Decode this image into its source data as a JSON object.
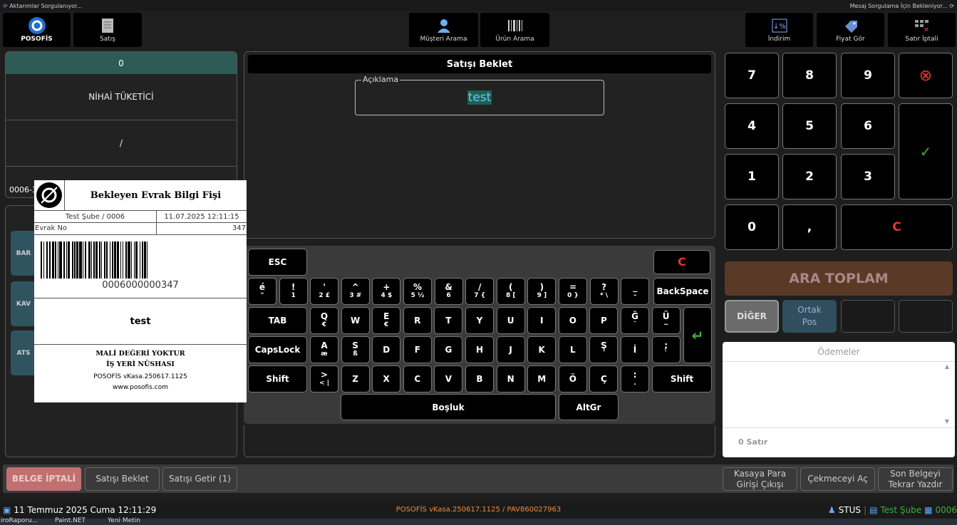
{
  "status": {
    "left": "Aktarımlar Sorgulanıyor...",
    "right": "Mesaj Sorgulama İçin Bekleniyor..."
  },
  "toolbar": {
    "posofis": "POSOFİS",
    "satis": "Satış",
    "musteri": "Müşteri Arama",
    "urun": "Ürün Arama",
    "indirim": "İndirim",
    "fiyat": "Fiyat Gör",
    "satir": "Satır İptali"
  },
  "customer": {
    "number": "0",
    "name": "NİHAİ TÜKETİCİ",
    "slash": "/",
    "code_partial": "0006-3"
  },
  "left_buttons": [
    "BAR",
    "KAV",
    "ATS"
  ],
  "dialog": {
    "title": "Satışı Beklet",
    "field_label": "Açıklama",
    "field_value": "test"
  },
  "keyboard": {
    "esc": "ESC",
    "clear": "C",
    "backspace": "BackSpace",
    "tab": "TAB",
    "capslock": "CapsLock",
    "shift": "Shift",
    "space": "Boşluk",
    "altgr": "AltGr",
    "row1": [
      [
        "é",
        "\""
      ],
      [
        "!",
        "1"
      ],
      [
        "'",
        "2 £"
      ],
      [
        "^",
        "3 #"
      ],
      [
        "+",
        "4 $"
      ],
      [
        "%",
        "5 ½"
      ],
      [
        "&",
        "6"
      ],
      [
        "/",
        "7 {"
      ],
      [
        "(",
        "8 ["
      ],
      [
        ")",
        "9 ]"
      ],
      [
        "=",
        "0 }"
      ],
      [
        "?",
        "* \\"
      ],
      [
        "_",
        "-"
      ]
    ],
    "row2": [
      [
        "Q",
        "€"
      ],
      [
        "W",
        ""
      ],
      [
        "E",
        "€"
      ],
      [
        "R",
        ""
      ],
      [
        "T",
        ""
      ],
      [
        "Y",
        ""
      ],
      [
        "U",
        ""
      ],
      [
        "I",
        ""
      ],
      [
        "O",
        ""
      ],
      [
        "P",
        ""
      ],
      [
        "Ğ",
        "¨"
      ],
      [
        "Ü",
        "~"
      ]
    ],
    "row3": [
      [
        "A",
        "æ"
      ],
      [
        "S",
        "ß"
      ],
      [
        "D",
        ""
      ],
      [
        "F",
        ""
      ],
      [
        "G",
        ""
      ],
      [
        "H",
        ""
      ],
      [
        "J",
        ""
      ],
      [
        "K",
        ""
      ],
      [
        "L",
        ""
      ],
      [
        "Ş",
        "´"
      ],
      [
        "İ",
        ""
      ],
      [
        ";",
        "`"
      ]
    ],
    "row4": [
      [
        ">",
        "< |"
      ],
      [
        "Z",
        ""
      ],
      [
        "X",
        ""
      ],
      [
        "C",
        ""
      ],
      [
        "V",
        ""
      ],
      [
        "B",
        ""
      ],
      [
        "N",
        ""
      ],
      [
        "M",
        ""
      ],
      [
        "Ö",
        ""
      ],
      [
        "Ç",
        ""
      ],
      [
        ":",
        "."
      ]
    ]
  },
  "numpad": {
    "k7": "7",
    "k8": "8",
    "k9": "9",
    "k4": "4",
    "k5": "5",
    "k6": "6",
    "k1": "1",
    "k2": "2",
    "k3": "3",
    "k0": "0",
    "comma": ",",
    "clear": "C"
  },
  "ara_toplam": "ARA TOPLAM",
  "diger": "DİĞER",
  "ortak_pos": "Ortak Pos",
  "payments": {
    "title": "Ödemeler",
    "rows": "0 Satır"
  },
  "receipt": {
    "title": "Bekleyen Evrak Bilgi Fişi",
    "branch": "Test Şube / 0006",
    "date": "11.07.2025 12:11:15",
    "evrak_label": "Evrak No",
    "evrak_no": "347",
    "barcode": "0006000000347",
    "desc": "test",
    "mali": "MALİ DEĞERİ YOKTUR",
    "nusha": "İŞ YERİ NÜSHASI",
    "version": "POSOFİS vKasa.250617.1125",
    "web": "www.posofis.com"
  },
  "bottom_actions": {
    "belge_iptali": "BELGE İPTALİ",
    "satisi_beklet": "Satışı Beklet",
    "satisi_getir": "Satışı Getir (1)",
    "kasaya": "Kasaya Para Girişi Çıkışı",
    "cekmece": "Çekmeceyi Aç",
    "son_belge": "Son Belgeyi Tekrar Yazdır"
  },
  "footer": {
    "date": "11 Temmuz 2025 Cuma 12:11:29",
    "version": "POSOFİS vKasa.250617.1125 / PAV860027963",
    "status": "STUS",
    "branch": "Test Şube",
    "register": "0006"
  },
  "taskbar": [
    "iroRaporu...",
    "Paint.NET",
    "Yeni Metin"
  ],
  "colors": {
    "teal": "#2f5b57",
    "orange": "#f08a3c",
    "red": "#e02020",
    "green": "#3ab03a",
    "arabrown": "#5a3a26"
  }
}
